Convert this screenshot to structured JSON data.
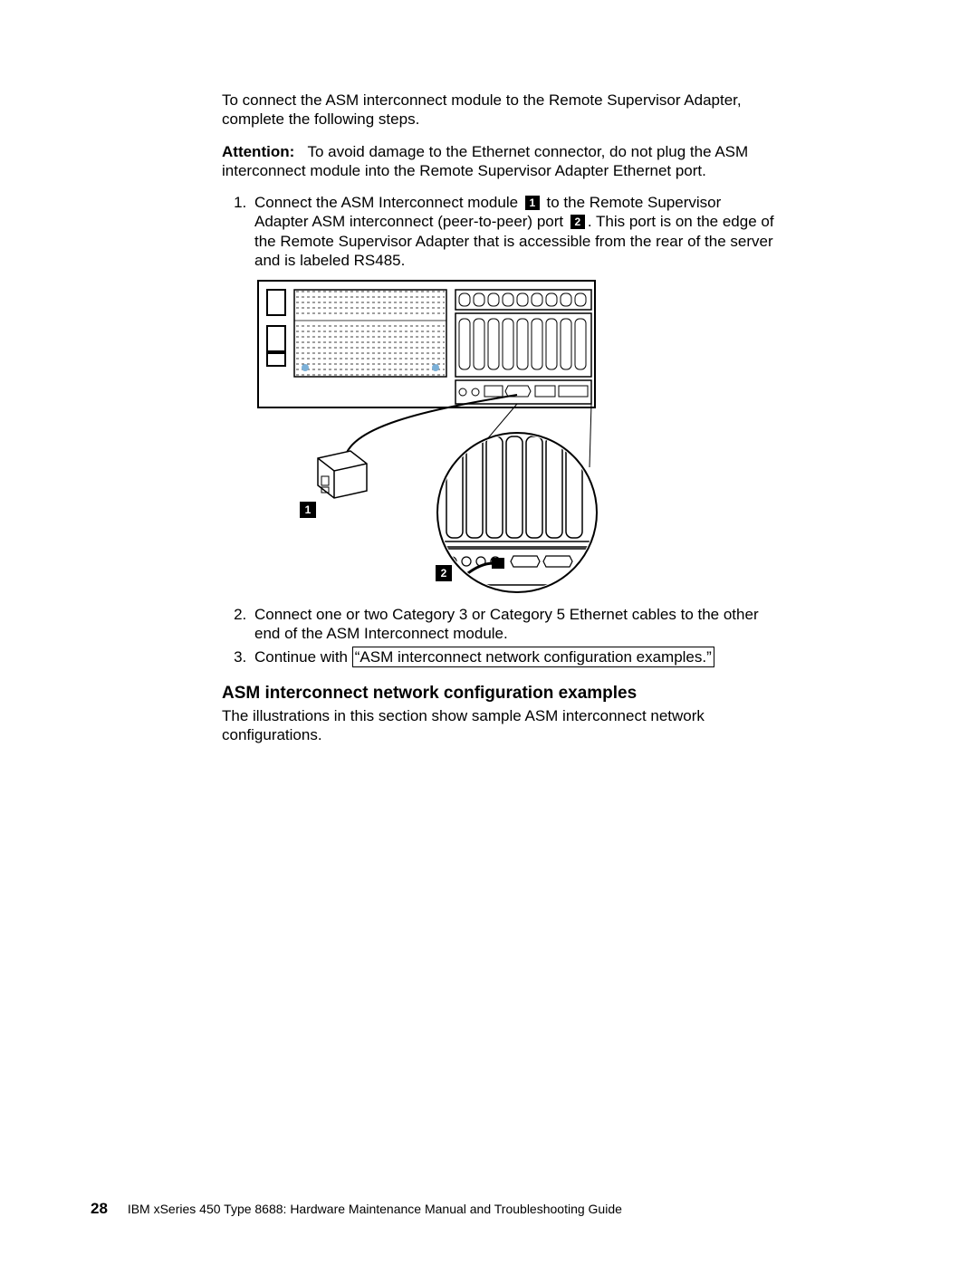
{
  "intro": "To connect the ASM interconnect module to the Remote Supervisor Adapter, complete the following steps.",
  "attention_label": "Attention:",
  "attention_body": "To avoid damage to the Ethernet connector, do not plug the ASM interconnect module into the Remote Supervisor Adapter Ethernet port.",
  "steps": {
    "s1a": "Connect the ASM Interconnect module",
    "s1b": "to the Remote Supervisor Adapter ASM interconnect (peer-to-peer) port",
    "s1c": ". This port is on the edge of the Remote Supervisor Adapter that is accessible from the rear of the server and is labeled RS485.",
    "callout1": "1",
    "callout2": "2",
    "s2": "Connect one or two Category 3 or Category 5 Ethernet cables to the other end of the ASM Interconnect module.",
    "s3a": "Continue with",
    "s3_link": "“ASM interconnect network configuration examples.”"
  },
  "diagram_callouts": {
    "c1": "1",
    "c2": "2"
  },
  "heading": "ASM interconnect network configuration examples",
  "heading_body": "The illustrations in this section show sample ASM interconnect network configurations.",
  "footer": {
    "page": "28",
    "text": "IBM xSeries 450 Type 8688:  Hardware Maintenance Manual and Troubleshooting Guide"
  }
}
